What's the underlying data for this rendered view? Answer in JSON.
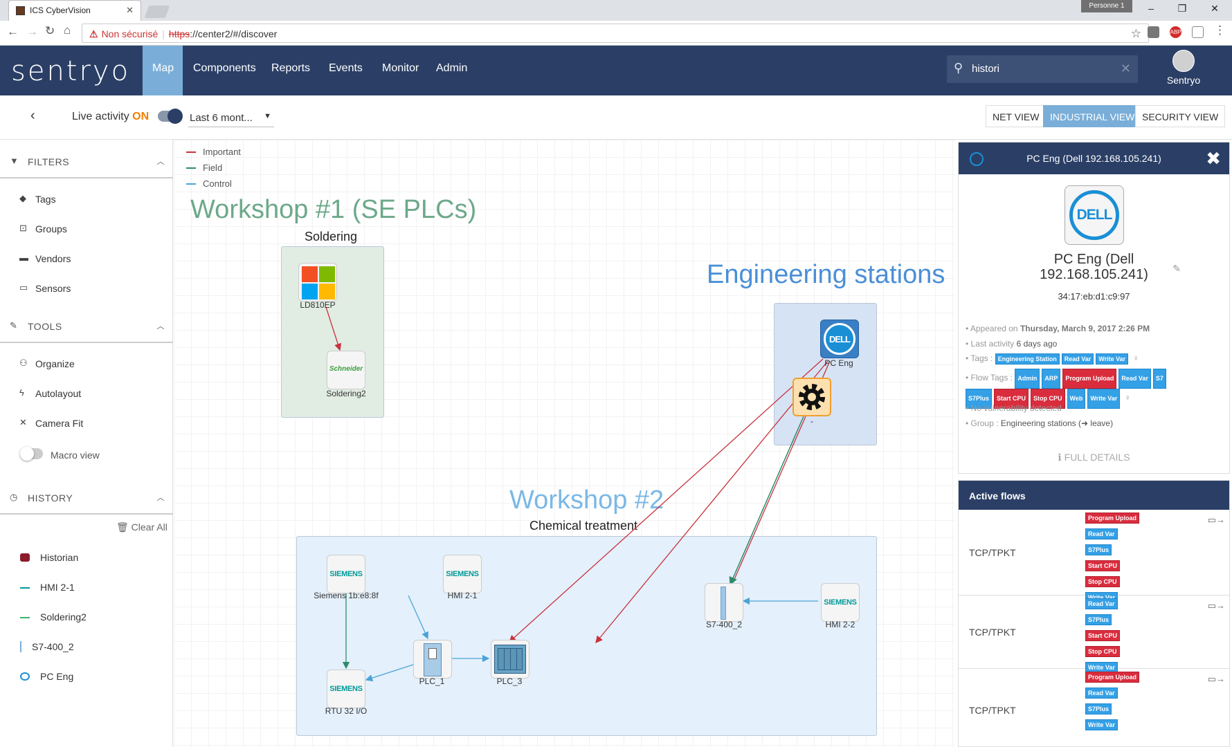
{
  "browser": {
    "tab_title": "ICS CyberVision",
    "profile": "Personne 1",
    "not_secure": "Non sécurisé",
    "url_scheme": "https",
    "url_rest": "://center2/#/discover"
  },
  "app": {
    "logo": "sentryo",
    "nav": [
      "Map",
      "Components",
      "Reports",
      "Events",
      "Monitor",
      "Admin"
    ],
    "active_nav": "Map",
    "search_value": "histori",
    "user": "Sentryo"
  },
  "toolbar": {
    "live_label": "Live activity",
    "live_state": "ON",
    "period": "Last 6 mont...",
    "views": [
      "NET VIEW",
      "INDUSTRIAL VIEW",
      "SECURITY VIEW"
    ],
    "active_view": "INDUSTRIAL VIEW"
  },
  "sidebar": {
    "filters_title": "FILTERS",
    "filters": [
      "Tags",
      "Groups",
      "Vendors",
      "Sensors"
    ],
    "tools_title": "TOOLS",
    "tools": [
      "Organize",
      "Autolayout",
      "Camera Fit"
    ],
    "macro_view": "Macro view",
    "history_title": "HISTORY",
    "clear_all": "Clear All",
    "history": [
      "Historian",
      "HMI 2-1",
      "Soldering2",
      "S7-400_2",
      "PC Eng"
    ]
  },
  "map": {
    "legend": [
      {
        "label": "Important",
        "color": "#c8323c"
      },
      {
        "label": "Field",
        "color": "#2e8b6a"
      },
      {
        "label": "Control",
        "color": "#4aa3d8"
      }
    ],
    "workshop1_title": "Workshop #1 (SE PLCs)",
    "soldering_label": "Soldering",
    "eng_title": "Engineering stations",
    "workshop2_title": "Workshop #2",
    "chem_label": "Chemical treatment",
    "nodes": {
      "ld810ep": "LD810EP",
      "soldering2": "Soldering2",
      "schneider_logo": "Schneider",
      "pc_eng": "PC Eng",
      "gear": "-",
      "siemens_1b": "Siemens 1b:e8:8f",
      "hmi21": "HMI 2-1",
      "s7400_2": "S7-400_2",
      "hmi22": "HMI 2-2",
      "plc1": "PLC_1",
      "plc3": "PLC_3",
      "rtu": "RTU 32 I/O",
      "siemens_logo": "SIEMENS",
      "dell_logo": "DELL"
    }
  },
  "details": {
    "header": "PC Eng (Dell 192.168.105.241)",
    "name": "PC Eng (Dell 192.168.105.241)",
    "mac": "34:17:eb:d1:c9:97",
    "appeared_label": "Appeared on",
    "appeared_value": "Thursday, March 9, 2017 2:26 PM",
    "last_activity_label": "Last activity",
    "last_activity_value": "6 days ago",
    "tags_label": "Tags :",
    "tags": [
      "Engineering Station",
      "Read Var",
      "Write Var"
    ],
    "flow_tags_label": "Flow Tags :",
    "flow_tags": [
      {
        "label": "Admin",
        "critical": false
      },
      {
        "label": "ARP",
        "critical": false
      },
      {
        "label": "Program Upload",
        "critical": true
      },
      {
        "label": "Read Var",
        "critical": false
      },
      {
        "label": "S7",
        "critical": false
      },
      {
        "label": "S7Plus",
        "critical": false
      },
      {
        "label": "Start CPU",
        "critical": true
      },
      {
        "label": "Stop CPU",
        "critical": true
      },
      {
        "label": "Web",
        "critical": false
      },
      {
        "label": "Write Var",
        "critical": false
      }
    ],
    "vuln": "No vulnerability detected",
    "group_label": "Group :",
    "group_value": "Engineering stations (",
    "group_leave": "leave)",
    "full_details": "FULL DETAILS"
  },
  "active_flows": {
    "title": "Active flows",
    "rows": [
      {
        "protocol": "TCP/TPKT",
        "tags": [
          {
            "label": "Program Upload",
            "critical": true
          },
          {
            "label": "Read Var",
            "critical": false
          },
          {
            "label": "S7Plus",
            "critical": false
          },
          {
            "label": "Start CPU",
            "critical": true
          },
          {
            "label": "Stop CPU",
            "critical": true
          },
          {
            "label": "Write Var",
            "critical": false
          }
        ]
      },
      {
        "protocol": "TCP/TPKT",
        "tags": [
          {
            "label": "Read Var",
            "critical": false
          },
          {
            "label": "S7Plus",
            "critical": false
          },
          {
            "label": "Start CPU",
            "critical": true
          },
          {
            "label": "Stop CPU",
            "critical": true
          },
          {
            "label": "Write Var",
            "critical": false
          }
        ]
      },
      {
        "protocol": "TCP/TPKT",
        "tags": [
          {
            "label": "Program Upload",
            "critical": true
          },
          {
            "label": "Read Var",
            "critical": false
          },
          {
            "label": "S7Plus",
            "critical": false
          },
          {
            "label": "Write Var",
            "critical": false
          }
        ]
      }
    ]
  }
}
